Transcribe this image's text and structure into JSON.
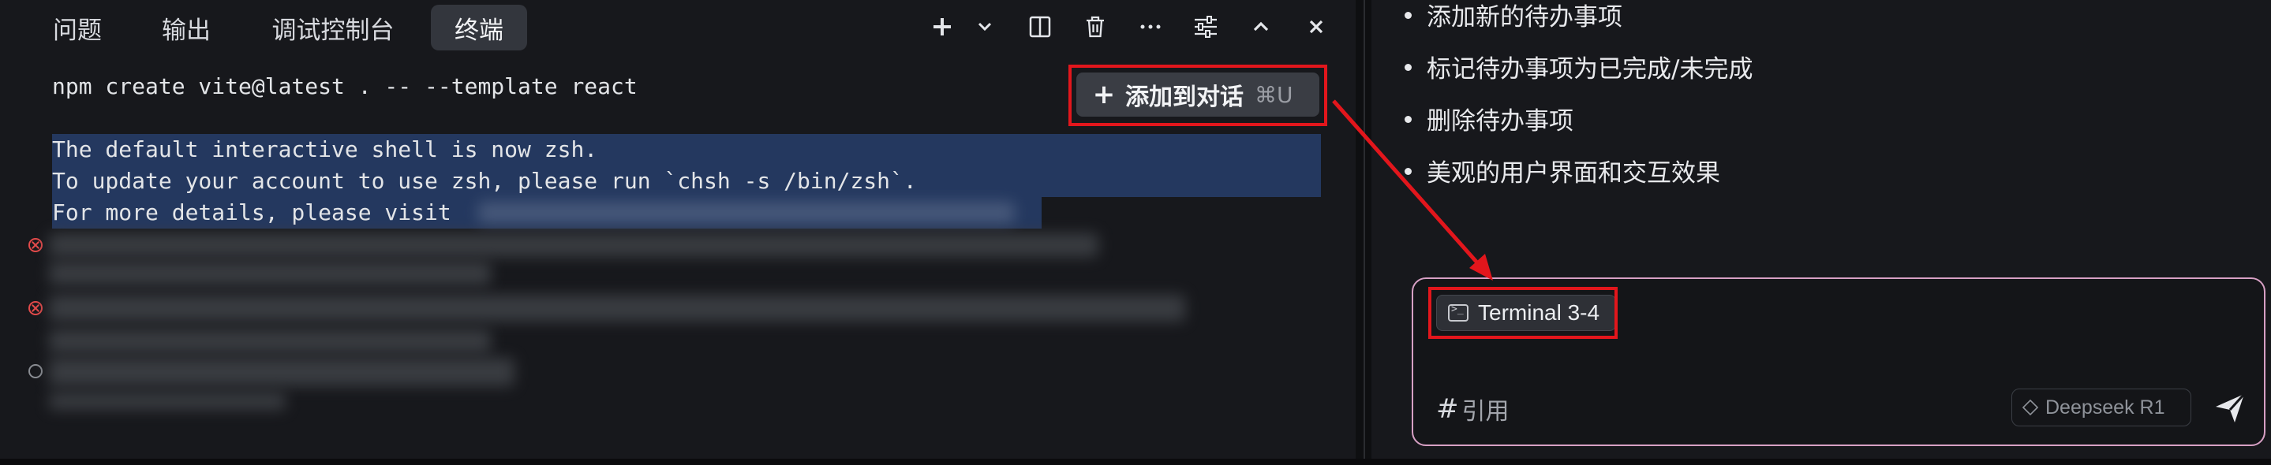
{
  "terminal_panel": {
    "tabs": [
      {
        "label": "问题"
      },
      {
        "label": "输出"
      },
      {
        "label": "调试控制台"
      },
      {
        "label": "终端",
        "active": true
      }
    ],
    "toolbar_icons": [
      "plus-icon",
      "chevron-down-icon",
      "split-icon",
      "trash-icon",
      "more-icon",
      "settings-sliders-icon",
      "chevron-up-icon",
      "close-icon"
    ],
    "command": "npm create vite@latest . -- --template react",
    "output_lines": [
      "The default interactive shell is now zsh.",
      "To update your account to use zsh, please run `chsh -s /bin/zsh`.",
      "For more details, please visit"
    ],
    "add_to_chat": {
      "label": "添加到对话",
      "shortcut": "⌘U"
    }
  },
  "chat_panel": {
    "feature_list": [
      "添加新的待办事项",
      "标记待办事项为已完成/未完成",
      "删除待办事项",
      "美观的用户界面和交互效果"
    ],
    "composer": {
      "context_chip": "Terminal 3-4",
      "reference_label": "引用",
      "reference_hash": "#",
      "model_selector": "Deepseek R1"
    }
  },
  "colors": {
    "highlight_red": "#e2161c",
    "selection_blue": "#24385f",
    "composer_border": "#d7a0c4"
  }
}
